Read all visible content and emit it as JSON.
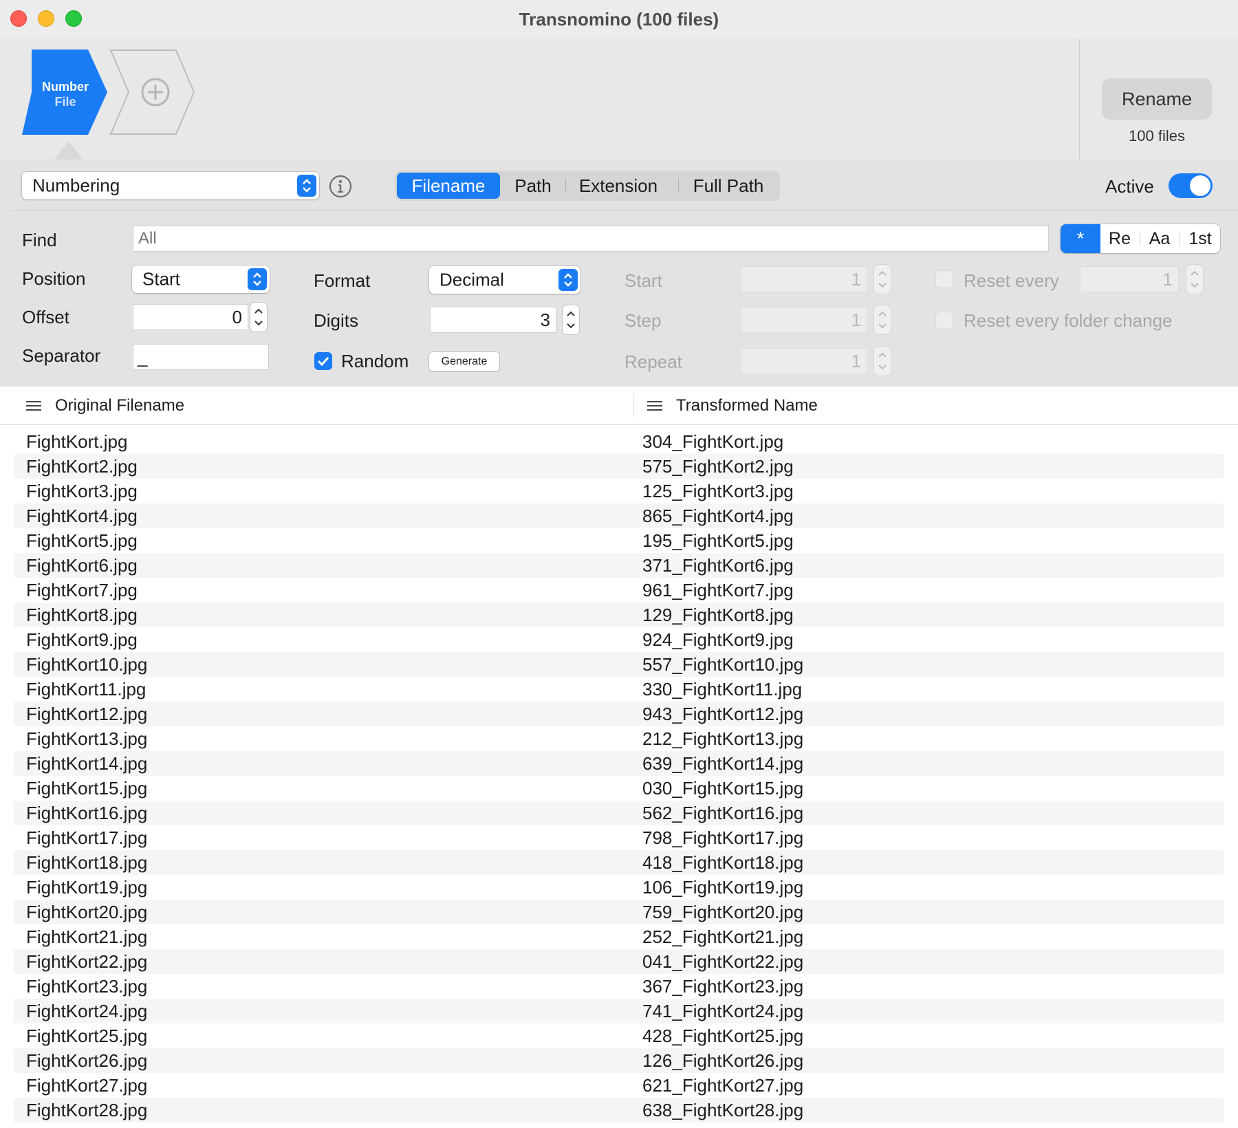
{
  "window": {
    "title": "Transnomino (100 files)"
  },
  "rule_chain": {
    "active_rule": {
      "line1": "Number",
      "line2": "File",
      "accent": "#1a7cf5"
    },
    "add_rule_icon": "plus-circle-icon"
  },
  "rename": {
    "label": "Rename",
    "count": "100 files"
  },
  "rule_editor": {
    "rule_type": "Numbering",
    "info_icon": "info-icon",
    "scope_tabs": [
      "Filename",
      "Path",
      "Extension",
      "Full Path"
    ],
    "active_scope": "Filename",
    "active_label": "Active",
    "active_on": true
  },
  "find": {
    "label": "Find",
    "placeholder": "All",
    "modes": [
      "*",
      "Re",
      "Aa",
      "1st"
    ],
    "active_mode": "*"
  },
  "options": {
    "position": {
      "label": "Position",
      "value": "Start"
    },
    "offset": {
      "label": "Offset",
      "value": "0"
    },
    "separator": {
      "label": "Separator",
      "value": "_"
    },
    "format": {
      "label": "Format",
      "value": "Decimal"
    },
    "digits": {
      "label": "Digits",
      "value": "3"
    },
    "random": {
      "label": "Random",
      "checked": true
    },
    "generate_label": "Generate",
    "start": {
      "label": "Start",
      "value": "1"
    },
    "step": {
      "label": "Step",
      "value": "1"
    },
    "repeat": {
      "label": "Repeat",
      "value": "1"
    },
    "reset_every": {
      "label": "Reset every",
      "value": "1",
      "checked": false
    },
    "reset_folder": {
      "label": "Reset every folder change",
      "checked": false
    }
  },
  "table": {
    "columns": [
      "Original Filename",
      "Transformed Name"
    ],
    "rows": [
      [
        "FightKort.jpg",
        "304_FightKort.jpg"
      ],
      [
        "FightKort2.jpg",
        "575_FightKort2.jpg"
      ],
      [
        "FightKort3.jpg",
        "125_FightKort3.jpg"
      ],
      [
        "FightKort4.jpg",
        "865_FightKort4.jpg"
      ],
      [
        "FightKort5.jpg",
        "195_FightKort5.jpg"
      ],
      [
        "FightKort6.jpg",
        "371_FightKort6.jpg"
      ],
      [
        "FightKort7.jpg",
        "961_FightKort7.jpg"
      ],
      [
        "FightKort8.jpg",
        "129_FightKort8.jpg"
      ],
      [
        "FightKort9.jpg",
        "924_FightKort9.jpg"
      ],
      [
        "FightKort10.jpg",
        "557_FightKort10.jpg"
      ],
      [
        "FightKort11.jpg",
        "330_FightKort11.jpg"
      ],
      [
        "FightKort12.jpg",
        "943_FightKort12.jpg"
      ],
      [
        "FightKort13.jpg",
        "212_FightKort13.jpg"
      ],
      [
        "FightKort14.jpg",
        "639_FightKort14.jpg"
      ],
      [
        "FightKort15.jpg",
        "030_FightKort15.jpg"
      ],
      [
        "FightKort16.jpg",
        "562_FightKort16.jpg"
      ],
      [
        "FightKort17.jpg",
        "798_FightKort17.jpg"
      ],
      [
        "FightKort18.jpg",
        "418_FightKort18.jpg"
      ],
      [
        "FightKort19.jpg",
        "106_FightKort19.jpg"
      ],
      [
        "FightKort20.jpg",
        "759_FightKort20.jpg"
      ],
      [
        "FightKort21.jpg",
        "252_FightKort21.jpg"
      ],
      [
        "FightKort22.jpg",
        "041_FightKort22.jpg"
      ],
      [
        "FightKort23.jpg",
        "367_FightKort23.jpg"
      ],
      [
        "FightKort24.jpg",
        "741_FightKort24.jpg"
      ],
      [
        "FightKort25.jpg",
        "428_FightKort25.jpg"
      ],
      [
        "FightKort26.jpg",
        "126_FightKort26.jpg"
      ],
      [
        "FightKort27.jpg",
        "621_FightKort27.jpg"
      ],
      [
        "FightKort28.jpg",
        "638_FightKort28.jpg"
      ]
    ]
  }
}
